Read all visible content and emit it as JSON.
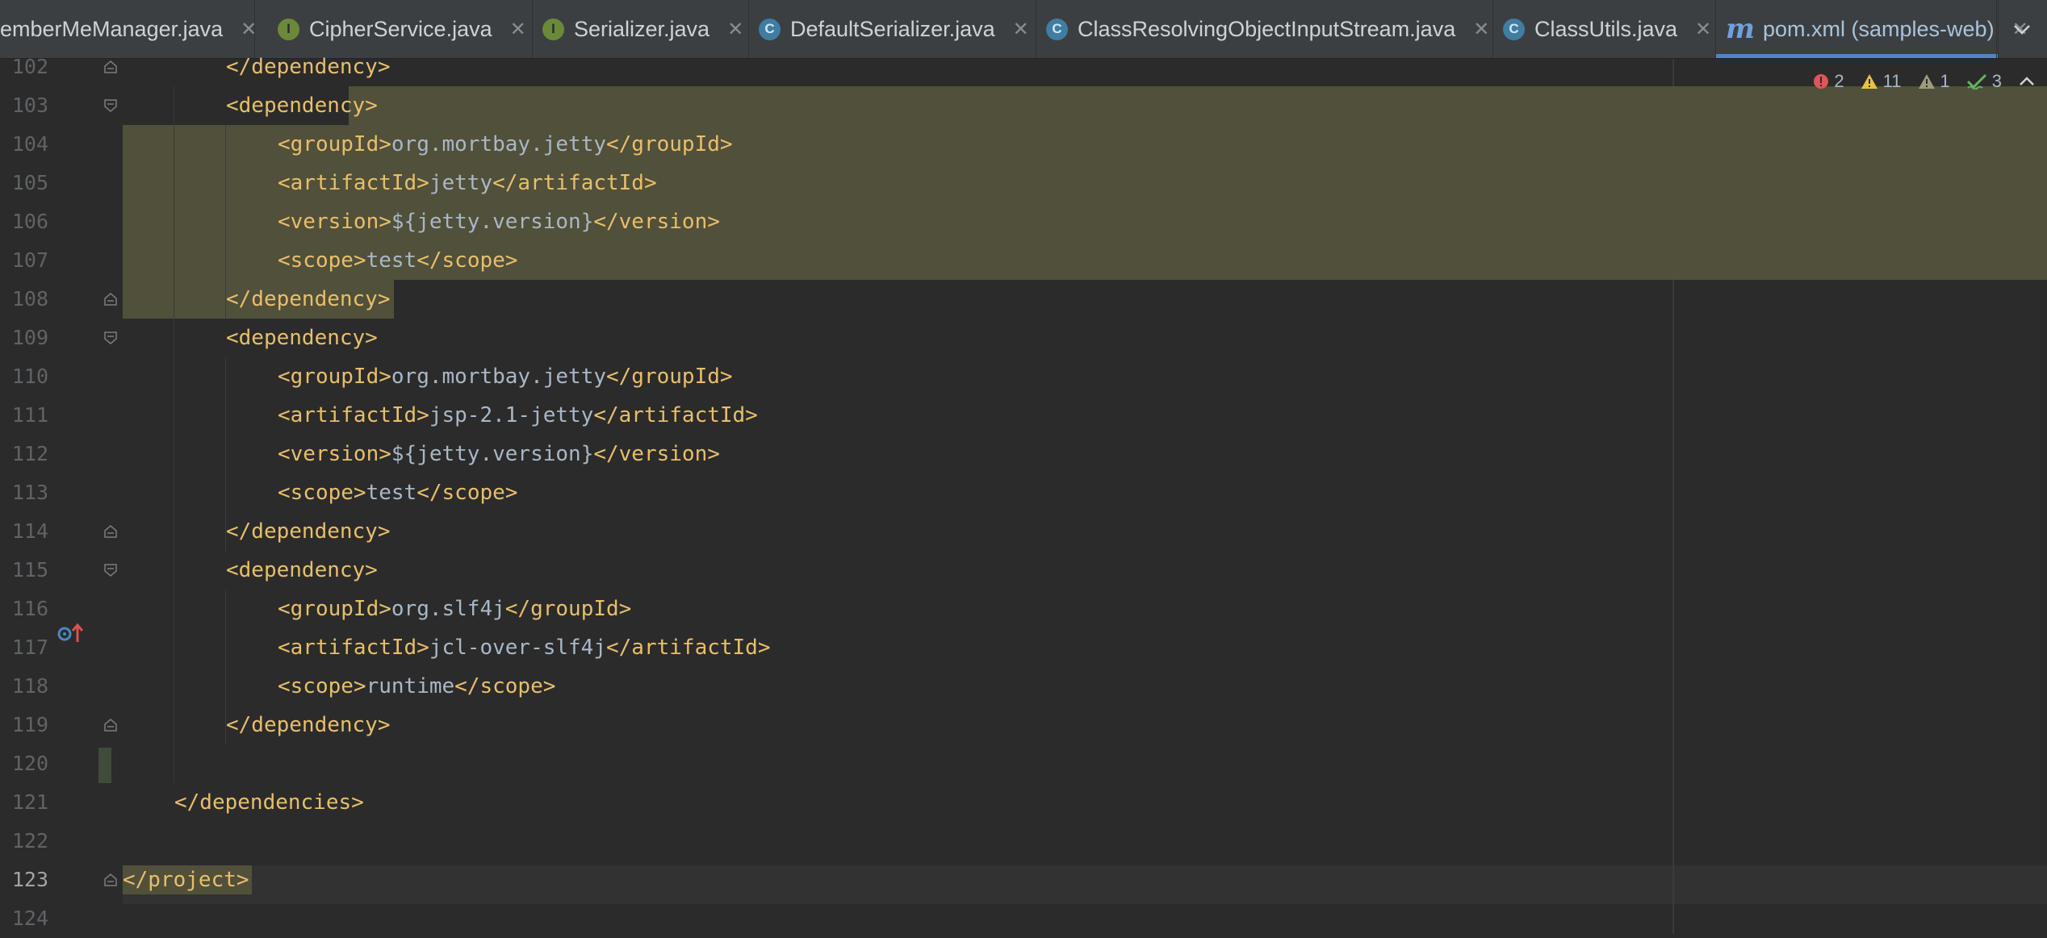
{
  "tabs": [
    {
      "label": "emberMeManager.java",
      "icon": "",
      "kind": "none"
    },
    {
      "label": "CipherService.java",
      "icon": "I",
      "kind": "iface"
    },
    {
      "label": "Serializer.java",
      "icon": "I",
      "kind": "iface"
    },
    {
      "label": "DefaultSerializer.java",
      "icon": "C",
      "kind": "klass"
    },
    {
      "label": "ClassResolvingObjectInputStream.java",
      "icon": "C",
      "kind": "klass"
    },
    {
      "label": "ClassUtils.java",
      "icon": "C",
      "kind": "klass"
    },
    {
      "label": "pom.xml (samples-web)",
      "icon": "m",
      "kind": "maven",
      "active": true
    }
  ],
  "close_glyph": "✕",
  "inspections": {
    "errors": "2",
    "warnings": "11",
    "weak_warnings": "1",
    "typos": "3"
  },
  "lines": [
    {
      "n": "102",
      "parts": [
        [
          "tag",
          "</dependency>"
        ]
      ]
    },
    {
      "n": "103",
      "parts": [
        [
          "tag",
          "<dependency>"
        ]
      ]
    },
    {
      "n": "104",
      "parts": [
        [
          "tag",
          "<groupId>"
        ],
        [
          "txt",
          "org.mortbay.jetty"
        ],
        [
          "tag",
          "</groupId>"
        ]
      ]
    },
    {
      "n": "105",
      "parts": [
        [
          "tag",
          "<artifactId>"
        ],
        [
          "txt",
          "jetty"
        ],
        [
          "tag",
          "</artifactId>"
        ]
      ]
    },
    {
      "n": "106",
      "parts": [
        [
          "tag",
          "<version>"
        ],
        [
          "txt",
          "${jetty.version}"
        ],
        [
          "tag",
          "</version>"
        ]
      ]
    },
    {
      "n": "107",
      "parts": [
        [
          "tag",
          "<scope>"
        ],
        [
          "txt",
          "test"
        ],
        [
          "tag",
          "</scope>"
        ]
      ]
    },
    {
      "n": "108",
      "parts": [
        [
          "tag",
          "</dependency>"
        ]
      ]
    },
    {
      "n": "109",
      "parts": [
        [
          "tag",
          "<dependency>"
        ]
      ]
    },
    {
      "n": "110",
      "parts": [
        [
          "tag",
          "<groupId>"
        ],
        [
          "txt",
          "org.mortbay.jetty"
        ],
        [
          "tag",
          "</groupId>"
        ]
      ]
    },
    {
      "n": "111",
      "parts": [
        [
          "tag",
          "<artifactId>"
        ],
        [
          "txt",
          "jsp-2.1-jetty"
        ],
        [
          "tag",
          "</artifactId>"
        ]
      ]
    },
    {
      "n": "112",
      "parts": [
        [
          "tag",
          "<version>"
        ],
        [
          "txt",
          "${jetty.version}"
        ],
        [
          "tag",
          "</version>"
        ]
      ]
    },
    {
      "n": "113",
      "parts": [
        [
          "tag",
          "<scope>"
        ],
        [
          "txt",
          "test"
        ],
        [
          "tag",
          "</scope>"
        ]
      ]
    },
    {
      "n": "114",
      "parts": [
        [
          "tag",
          "</dependency>"
        ]
      ]
    },
    {
      "n": "115",
      "parts": [
        [
          "tag",
          "<dependency>"
        ]
      ]
    },
    {
      "n": "116",
      "parts": [
        [
          "tag",
          "<groupId>"
        ],
        [
          "txt",
          "org.slf4j"
        ],
        [
          "tag",
          "</groupId>"
        ]
      ]
    },
    {
      "n": "117",
      "parts": [
        [
          "tag",
          "<artifactId>"
        ],
        [
          "txt",
          "jcl-over-slf4j"
        ],
        [
          "tag",
          "</artifactId>"
        ]
      ]
    },
    {
      "n": "118",
      "parts": [
        [
          "tag",
          "<scope>"
        ],
        [
          "txt",
          "runtime"
        ],
        [
          "tag",
          "</scope>"
        ]
      ]
    },
    {
      "n": "119",
      "parts": [
        [
          "tag",
          "</dependency>"
        ]
      ]
    },
    {
      "n": "120",
      "parts": []
    },
    {
      "n": "121",
      "parts": [
        [
          "tag",
          "</dependencies>"
        ]
      ]
    },
    {
      "n": "122",
      "parts": []
    },
    {
      "n": "123",
      "parts": [
        [
          "tag",
          "</project>"
        ]
      ],
      "current": true
    },
    {
      "n": "124",
      "parts": []
    }
  ],
  "colors": {
    "tag": "#e8bf6a",
    "text": "#a9b7c6",
    "selection": "#51503a",
    "error": "#e05555",
    "warning": "#e8c146",
    "typo": "#5fb65f"
  }
}
